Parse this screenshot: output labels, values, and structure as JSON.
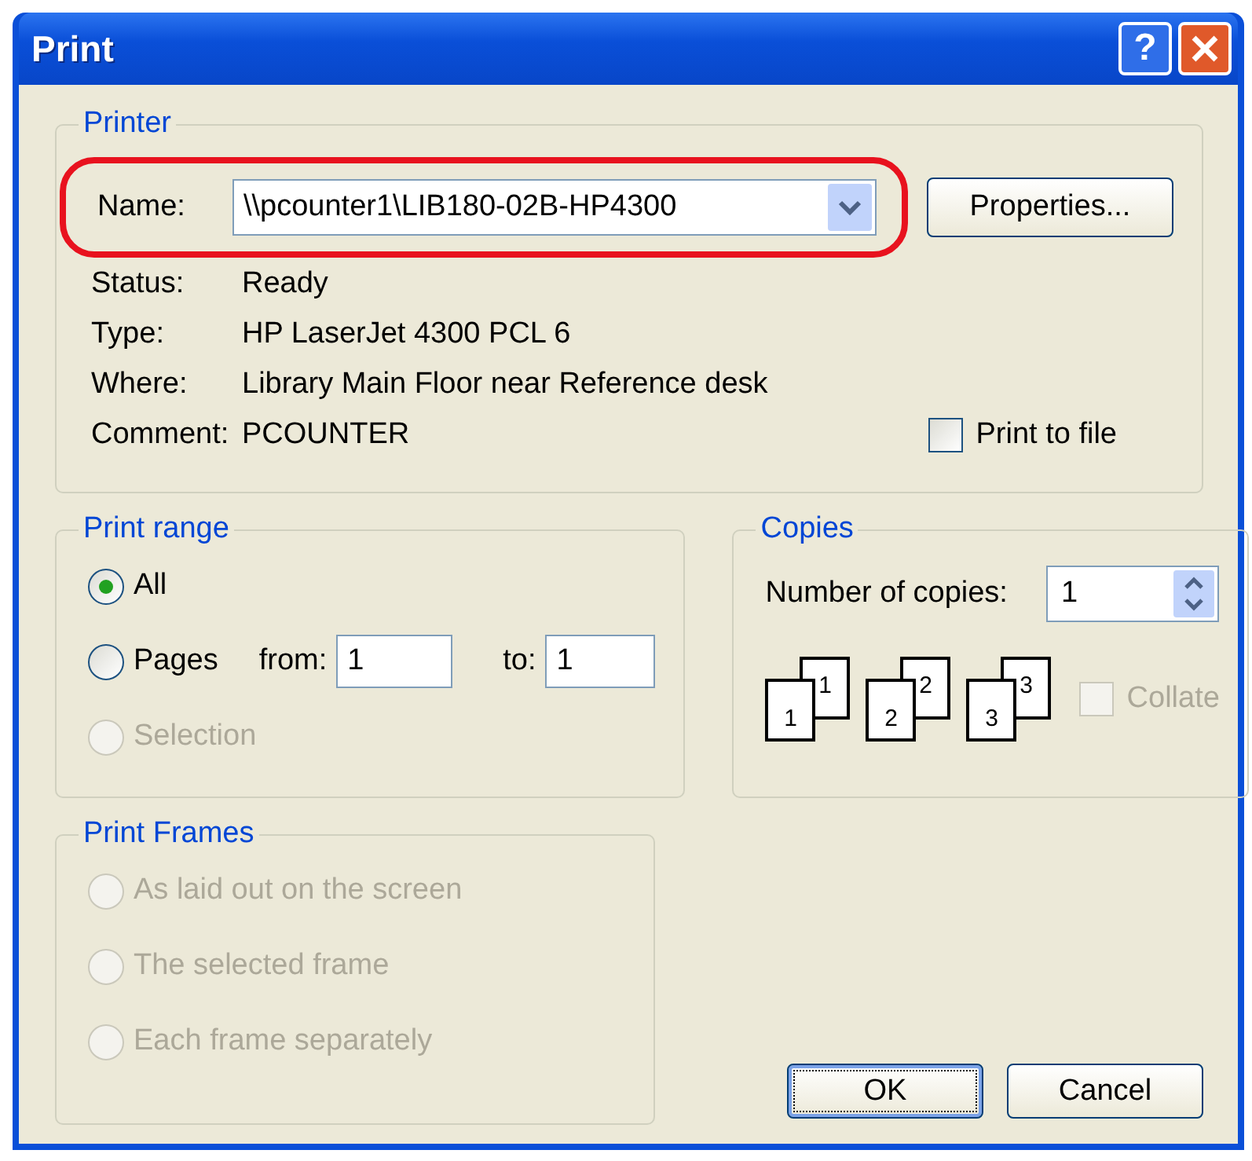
{
  "window": {
    "title": "Print",
    "help_button": "?"
  },
  "printer": {
    "legend": "Printer",
    "name_label": "Name:",
    "name_value": "\\\\pcounter1\\LIB180-02B-HP4300",
    "highlighted": true,
    "properties_button": "Properties...",
    "info": [
      {
        "label": "Status:",
        "value": "Ready"
      },
      {
        "label": "Type:",
        "value": "HP LaserJet 4300 PCL 6"
      },
      {
        "label": "Where:",
        "value": "Library Main Floor near Reference desk"
      },
      {
        "label": "Comment:",
        "value": "PCOUNTER"
      }
    ],
    "print_to_file": {
      "label": "Print to file",
      "checked": false
    }
  },
  "print_range": {
    "legend": "Print range",
    "options": [
      {
        "label": "All",
        "selected": true,
        "disabled": false
      },
      {
        "label": "Pages",
        "selected": false,
        "disabled": false,
        "range": {
          "from_label": "from:",
          "from_value": "1",
          "to_label": "to:",
          "to_value": "1"
        }
      },
      {
        "label": "Selection",
        "selected": false,
        "disabled": true
      }
    ]
  },
  "copies": {
    "legend": "Copies",
    "label": "Number of copies:",
    "value": "1",
    "page_stacks": [
      [
        "1",
        "1"
      ],
      [
        "2",
        "2"
      ],
      [
        "3",
        "3"
      ]
    ],
    "collate": {
      "label": "Collate",
      "checked": false,
      "disabled": true
    }
  },
  "print_frames": {
    "legend": "Print Frames",
    "options": [
      {
        "label": "As laid out on the screen",
        "selected": false,
        "disabled": true
      },
      {
        "label": "The selected frame",
        "selected": false,
        "disabled": true
      },
      {
        "label": "Each frame separately",
        "selected": false,
        "disabled": true
      }
    ]
  },
  "buttons": [
    {
      "label": "OK",
      "default": true
    },
    {
      "label": "Cancel",
      "default": false
    }
  ]
}
